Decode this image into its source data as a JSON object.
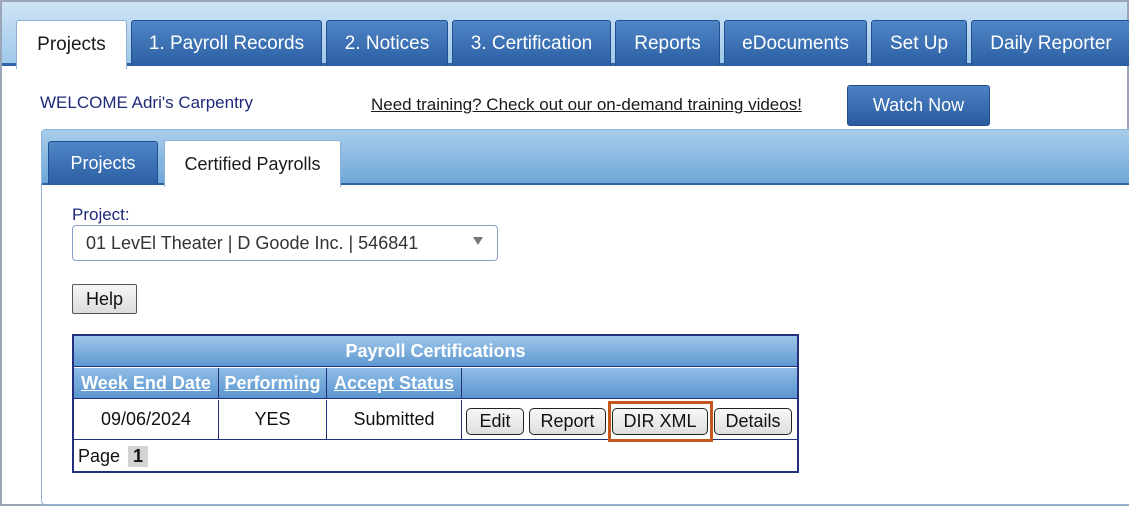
{
  "tabs": {
    "main": [
      {
        "label": "Projects",
        "active": true
      },
      {
        "label": "1. Payroll Records",
        "active": false
      },
      {
        "label": "2. Notices",
        "active": false
      },
      {
        "label": "3. Certification",
        "active": false
      },
      {
        "label": "Reports",
        "active": false
      },
      {
        "label": "eDocuments",
        "active": false
      },
      {
        "label": "Set Up",
        "active": false
      },
      {
        "label": "Daily Reporter",
        "active": false
      }
    ],
    "sub": [
      {
        "label": "Projects",
        "active": false
      },
      {
        "label": "Certified Payrolls",
        "active": true
      }
    ]
  },
  "header": {
    "welcome": "WELCOME Adri's Carpentry",
    "training_link": "Need training? Check out our on-demand training videos!",
    "watch_now": "Watch Now"
  },
  "form": {
    "project_label": "Project:",
    "project_value": "01 LevEl Theater | D Goode Inc. | 546841",
    "help_label": "Help"
  },
  "certifications": {
    "title": "Payroll Certifications",
    "columns": [
      "Week End Date",
      "Performing",
      "Accept Status"
    ],
    "rows": [
      {
        "week_end_date": "09/06/2024",
        "performing": "YES",
        "accept_status": "Submitted",
        "actions": [
          "Edit",
          "Report",
          "DIR XML",
          "Details"
        ]
      }
    ],
    "page_label": "Page",
    "current_page": "1"
  },
  "colors": {
    "tab_blue": "#2b5ea3",
    "header_gradient_top": "#cfe4f6",
    "table_border": "#24307e",
    "highlight": "#c5571a"
  }
}
